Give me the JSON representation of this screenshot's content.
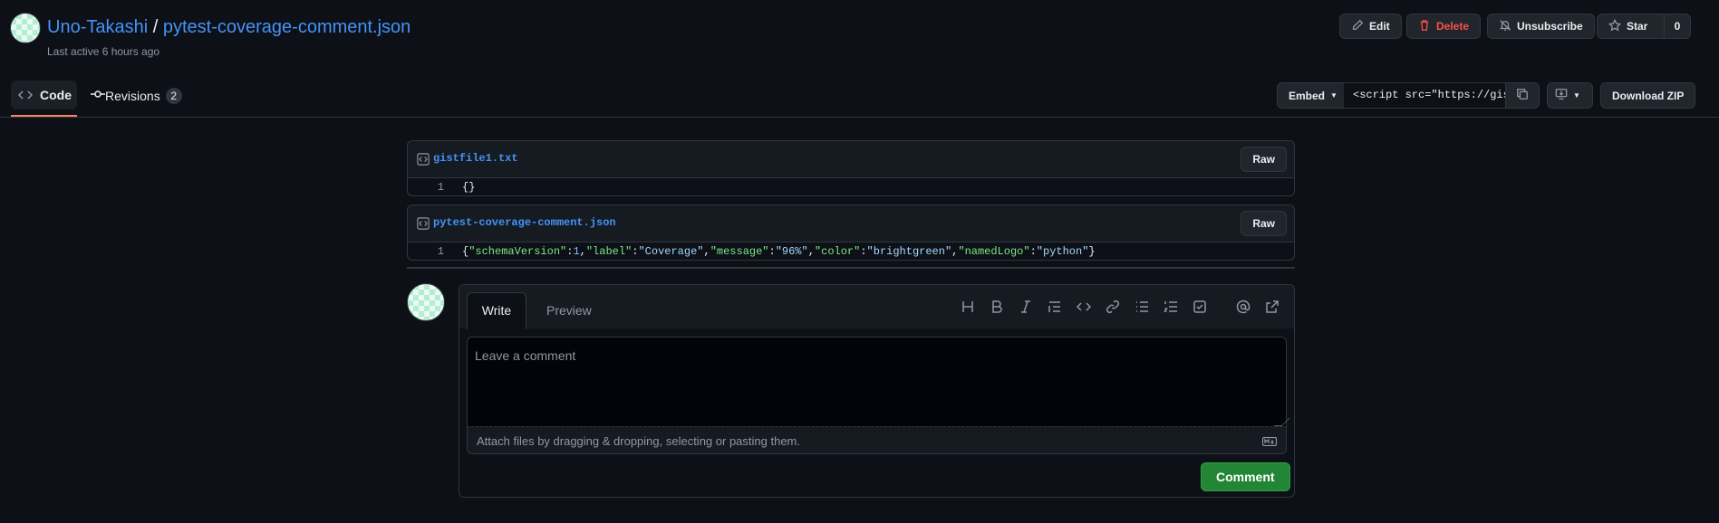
{
  "header": {
    "owner": "Uno-Takashi",
    "separator": "/",
    "gist_name": "pytest-coverage-comment.json",
    "last_active": "Last active 6 hours ago",
    "edit_label": "Edit",
    "delete_label": "Delete",
    "unsubscribe_label": "Unsubscribe",
    "star_label": "Star",
    "star_count": "0"
  },
  "tabs": {
    "code_label": "Code",
    "revisions_label": "Revisions",
    "revisions_count": "2"
  },
  "actions": {
    "embed_label": "Embed",
    "embed_value": "<script src=\"https://gist.github.com/Uno-Takashi/",
    "download_zip_label": "Download ZIP"
  },
  "files": [
    {
      "name": "gistfile1.txt",
      "raw_label": "Raw",
      "lines": [
        {
          "num": "1",
          "text": "{}"
        }
      ]
    },
    {
      "name": "pytest-coverage-comment.json",
      "raw_label": "Raw",
      "lines": [
        {
          "num": "1",
          "text": "{\"schemaVersion\":1,\"label\":\"Coverage\",\"message\":\"96%\",\"color\":\"brightgreen\",\"namedLogo\":\"python\"}"
        }
      ]
    }
  ],
  "comment": {
    "write_tab": "Write",
    "preview_tab": "Preview",
    "placeholder": "Leave a comment",
    "attach_hint": "Attach files by dragging & dropping, selecting or pasting them.",
    "submit_label": "Comment",
    "toolbar_icons": [
      "heading-icon",
      "bold-icon",
      "italic-icon",
      "quote-icon",
      "code-icon",
      "link-icon",
      "unordered-list-icon",
      "ordered-list-icon",
      "task-list-icon",
      "mention-icon",
      "reference-icon"
    ]
  },
  "colors": {
    "background": "#0d1117",
    "link": "#4493f8",
    "danger": "#f85149",
    "primary_button": "#238636",
    "tab_underline": "#f78166"
  }
}
